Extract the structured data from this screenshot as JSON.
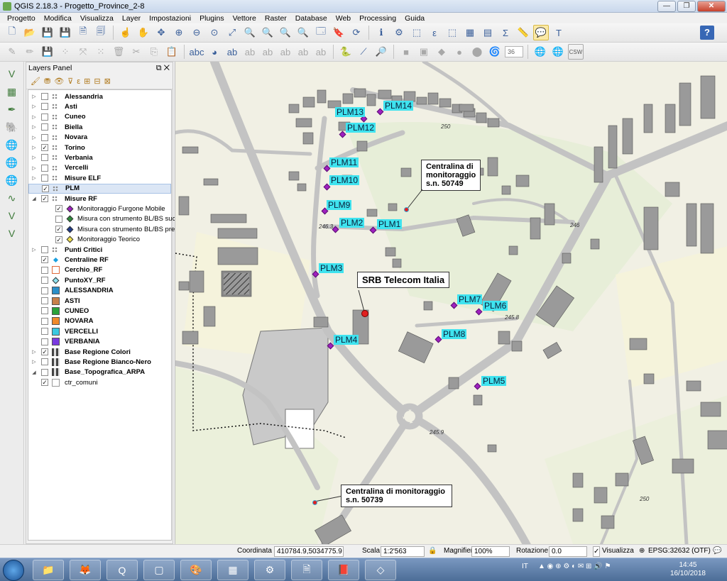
{
  "window": {
    "title": "QGIS 2.18.3 - Progetto_Province_2-8",
    "buttons": [
      "—",
      "❐",
      "✕"
    ]
  },
  "menu": [
    "Progetto",
    "Modifica",
    "Visualizza",
    "Layer",
    "Impostazioni",
    "Plugins",
    "Vettore",
    "Raster",
    "Database",
    "Web",
    "Processing",
    "Guida"
  ],
  "toolbar": {
    "font_size_value": "36",
    "crs_button": "CSW",
    "help": "?"
  },
  "layers_panel": {
    "title": "Layers Panel",
    "layers": [
      {
        "label": "Alessandria",
        "checked": false,
        "bold": true
      },
      {
        "label": "Asti",
        "checked": false,
        "bold": true
      },
      {
        "label": "Cuneo",
        "checked": false,
        "bold": true
      },
      {
        "label": "Biella",
        "checked": false,
        "bold": true
      },
      {
        "label": "Novara",
        "checked": false,
        "bold": true
      },
      {
        "label": "Torino",
        "checked": true,
        "bold": true
      },
      {
        "label": "Verbania",
        "checked": false,
        "bold": true
      },
      {
        "label": "Vercelli",
        "checked": false,
        "bold": true
      },
      {
        "label": "Misure ELF",
        "checked": false,
        "bold": true
      },
      {
        "label": "PLM",
        "checked": true,
        "bold": true
      },
      {
        "label": "Misure RF",
        "checked": true,
        "bold": true
      },
      {
        "label": "Monitoraggio Furgone Mobile",
        "checked": true,
        "bold": false
      },
      {
        "label": "Misura con strumento BL/BS suc...",
        "checked": false,
        "bold": false
      },
      {
        "label": "Misura con strumento BL/BS pre...",
        "checked": true,
        "bold": false
      },
      {
        "label": "Monitoraggio Teorico",
        "checked": true,
        "bold": false
      },
      {
        "label": "Punti Critici",
        "checked": false,
        "bold": true
      },
      {
        "label": "Centraline RF",
        "checked": true,
        "bold": true
      },
      {
        "label": "Cerchio_RF",
        "checked": false,
        "bold": true
      },
      {
        "label": "PuntoXY_RF",
        "checked": false,
        "bold": true
      },
      {
        "label": "ALESSANDRIA",
        "checked": false,
        "bold": true
      },
      {
        "label": "ASTI",
        "checked": false,
        "bold": true
      },
      {
        "label": "CUNEO",
        "checked": false,
        "bold": true
      },
      {
        "label": "NOVARA",
        "checked": false,
        "bold": true
      },
      {
        "label": "VERCELLI",
        "checked": false,
        "bold": true
      },
      {
        "label": "VERBANIA",
        "checked": false,
        "bold": true
      },
      {
        "label": "Base Regione Colori",
        "checked": true,
        "bold": true
      },
      {
        "label": "Base Regione Bianco-Nero",
        "checked": false,
        "bold": true
      },
      {
        "label": "Base_Topografica_ARPA",
        "checked": false,
        "bold": true
      },
      {
        "label": "ctr_comuni",
        "checked": true,
        "bold": false
      }
    ]
  },
  "map": {
    "plm_labels": [
      "PLM1",
      "PLM2",
      "PLM3",
      "PLM4",
      "PLM5",
      "PLM6",
      "PLM7",
      "PLM8",
      "PLM9",
      "PLM10",
      "PLM11",
      "PLM12",
      "PLM13",
      "PLM14"
    ],
    "callouts": {
      "srb": "SRB Telecom Italia",
      "centralina_50749": "Centralina di\nmonitoraggio\ns.n. 50749",
      "centralina_50739": "Centralina di monitoraggio\ns.n. 50739"
    },
    "elevations": [
      "250",
      "246.3",
      "246",
      "245.8",
      "245.9",
      "250"
    ]
  },
  "statusbar": {
    "coord_label": "Coordinata",
    "coord_value": "410784.9,5034775.9",
    "scale_label": "Scala",
    "scale_value": "1:2'563",
    "magnifier_label": "Magnifier",
    "magnifier_value": "100%",
    "rotation_label": "Rotazione",
    "rotation_value": "0.0",
    "render_label": "Visualizza",
    "crs": "EPSG:32632 (OTF)"
  },
  "taskbar": {
    "lang": "IT",
    "time": "14:45",
    "date": "16/10/2018"
  },
  "colors": {
    "plm_marker": "#a020c0",
    "plm_label_bg": "#3fe3ef",
    "centralina_marker": "#e02020",
    "srb_marker": "#e02020"
  }
}
